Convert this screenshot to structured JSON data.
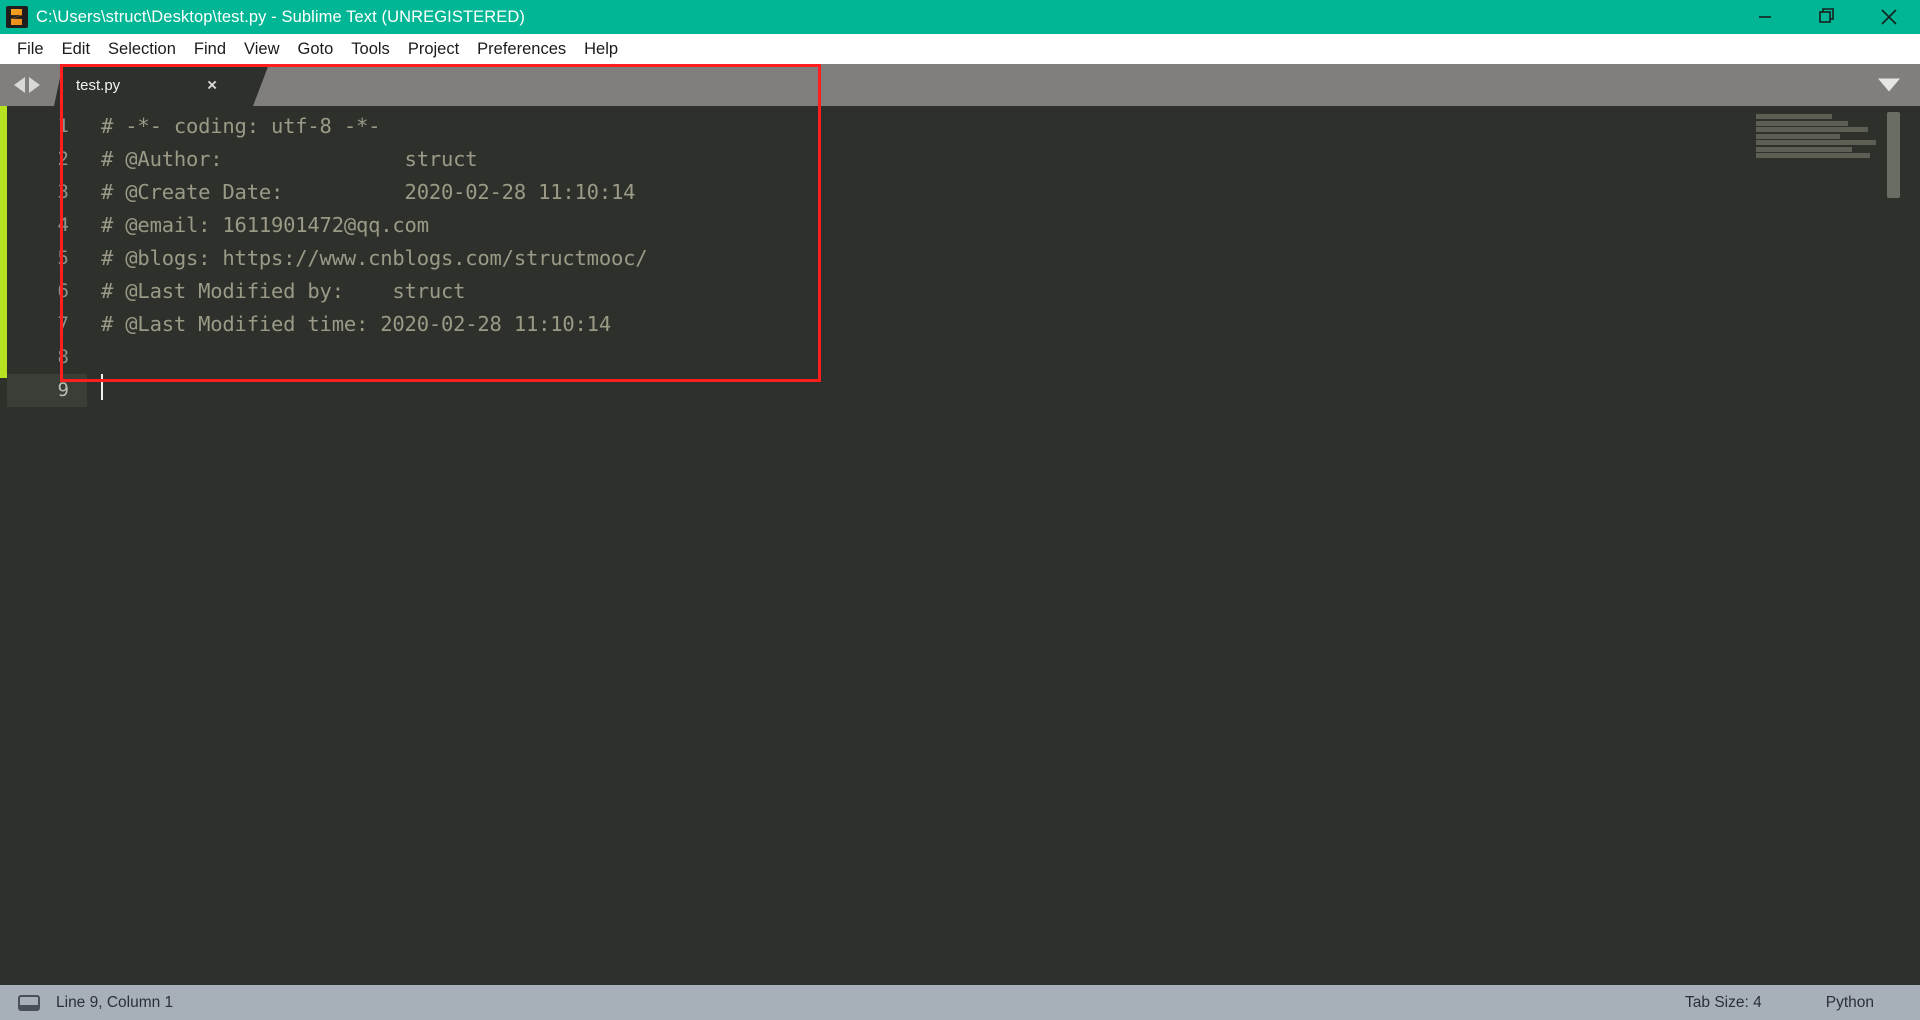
{
  "window": {
    "title": "C:\\Users\\struct\\Desktop\\test.py - Sublime Text (UNREGISTERED)",
    "logo_name": "sublime-text-logo",
    "controls": [
      {
        "name": "minimize",
        "label": "Minimize"
      },
      {
        "name": "maximize",
        "label": "Maximize"
      },
      {
        "name": "close",
        "label": "Close"
      }
    ],
    "titlebar_color": "#00b694"
  },
  "menubar": {
    "items": [
      {
        "label": "File"
      },
      {
        "label": "Edit"
      },
      {
        "label": "Selection"
      },
      {
        "label": "Find"
      },
      {
        "label": "View"
      },
      {
        "label": "Goto"
      },
      {
        "label": "Tools"
      },
      {
        "label": "Project"
      },
      {
        "label": "Preferences"
      },
      {
        "label": "Help"
      }
    ]
  },
  "tabbar": {
    "prev_arrow": "prev-tab-arrow",
    "next_arrow": "next-tab-arrow",
    "tabs": [
      {
        "label": "test.py",
        "close": "×",
        "active": true
      }
    ],
    "overflow_menu": "tab-overflow-chevron"
  },
  "editor": {
    "language": "Python",
    "cursor_line": 9,
    "lines": [
      {
        "num": "1",
        "text": "# -*- coding: utf-8 -*-"
      },
      {
        "num": "2",
        "text": "# @Author:               struct"
      },
      {
        "num": "3",
        "text": "# @Create Date:          2020-02-28 11:10:14"
      },
      {
        "num": "4",
        "text": "# @email: 1611901472@qq.com"
      },
      {
        "num": "5",
        "text": "# @blogs: https://www.cnblogs.com/structmooc/"
      },
      {
        "num": "6",
        "text": "# @Last Modified by:    struct"
      },
      {
        "num": "7",
        "text": "# @Last Modified time: 2020-02-28 11:10:14"
      },
      {
        "num": "8",
        "text": ""
      },
      {
        "num": "9",
        "text": ""
      }
    ],
    "comment_color": "#9a9a87",
    "background_color": "#2e312b",
    "gutter_accent_color": "#b6e220"
  },
  "annotation": {
    "highlight_box_color": "#ff1f1f",
    "name": "red-highlight-box"
  },
  "statusbar": {
    "position": "Line 9, Column 1",
    "tab_size": "Tab Size: 4",
    "syntax": "Python"
  }
}
